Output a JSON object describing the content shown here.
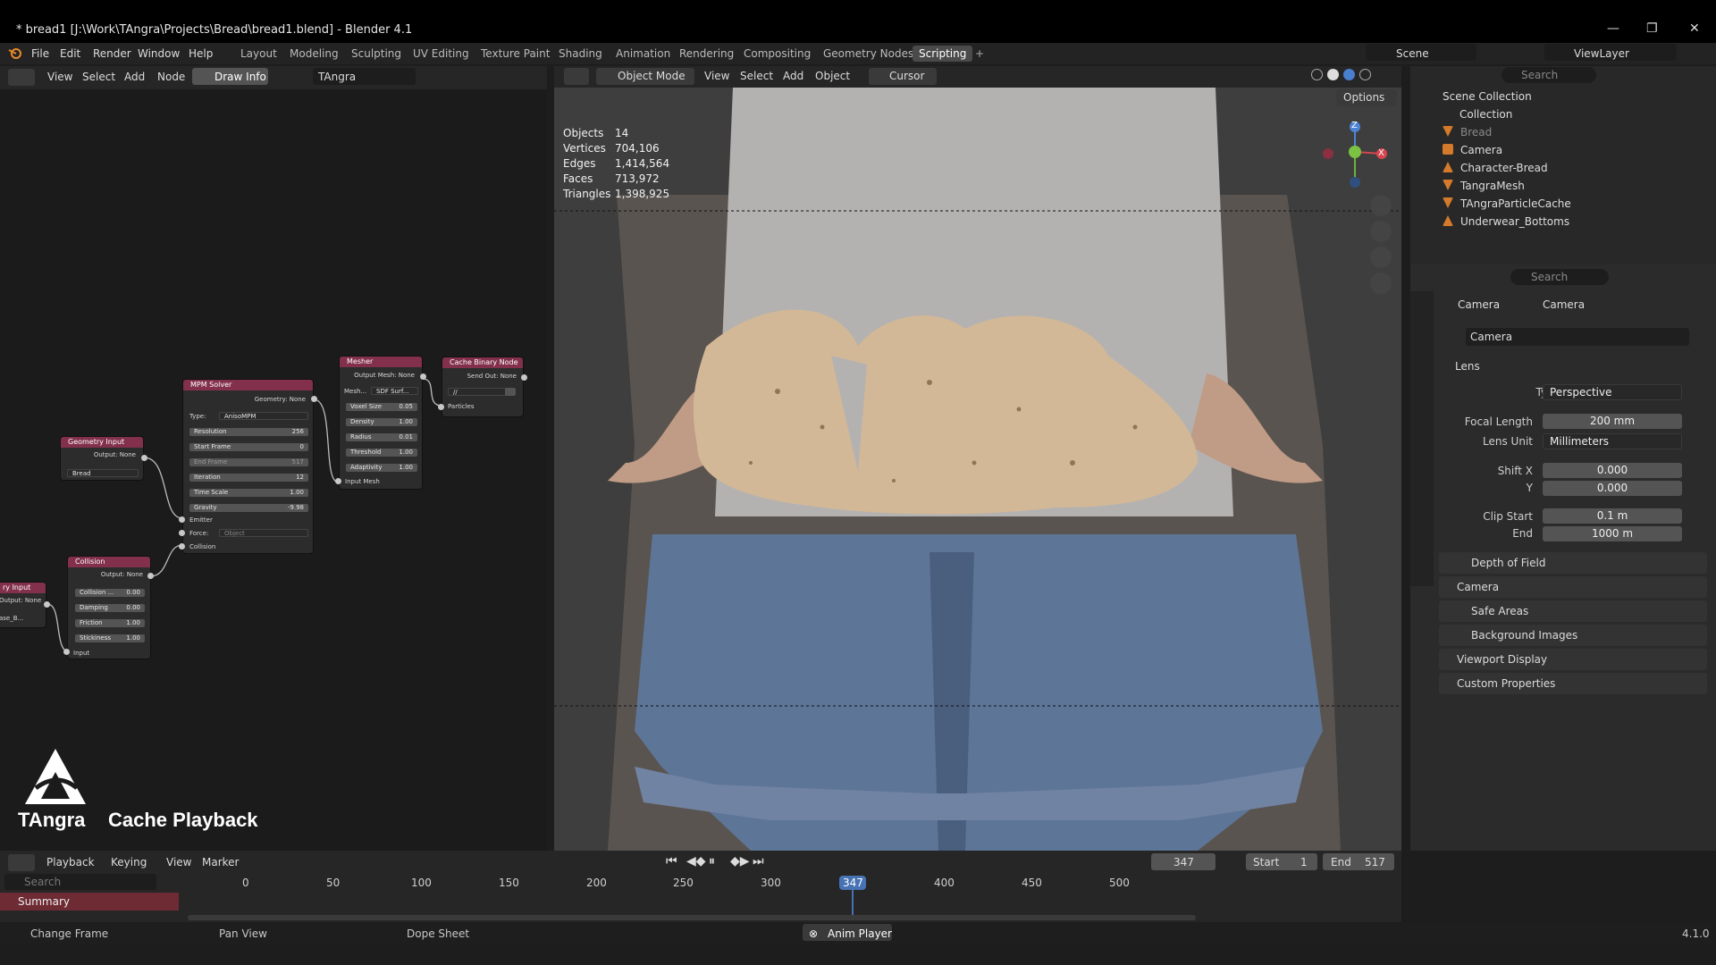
{
  "window": {
    "title": "* bread1 [J:\\Work\\TAngra\\Projects\\Bread\\bread1.blend] - Blender 4.1",
    "controls": [
      "—",
      "❐",
      "✕"
    ]
  },
  "menubar": {
    "menus": [
      "File",
      "Edit",
      "Render",
      "Window",
      "Help"
    ],
    "workspaces": [
      "Layout",
      "Modeling",
      "Sculpting",
      "UV Editing",
      "Texture Paint",
      "Shading",
      "Animation",
      "Rendering",
      "Compositing",
      "Geometry Nodes",
      "Scripting"
    ],
    "active_workspace": "Scripting",
    "scene": "Scene",
    "view_layer": "ViewLayer"
  },
  "node_editor": {
    "header": {
      "view": "View",
      "select": "Select",
      "add": "Add",
      "node": "Node",
      "draw_info": "Draw Info",
      "tree_name": "TAngra"
    },
    "nodes": {
      "geometry_input": {
        "title": "Geometry Input",
        "output": "Output: None",
        "object": "Bread"
      },
      "collision": {
        "title": "Collision",
        "output": "Output: None",
        "fields": [
          [
            "Collision ...",
            "0.00"
          ],
          [
            "Damping",
            "0.00"
          ],
          [
            "Friction",
            "1.00"
          ],
          [
            "Stickiness",
            "1.00"
          ]
        ],
        "input": "Input"
      },
      "partial_input": {
        "title": "ry Input",
        "output": "Output: None",
        "object": "ase_B..."
      },
      "mpm_solver": {
        "title": "MPM Solver",
        "output": "Geometry: None",
        "type_label": "Type:",
        "type_value": "AnisoMPM",
        "fields": [
          [
            "Resolution",
            "256"
          ],
          [
            "Start Frame",
            "0"
          ],
          [
            "End Frame",
            "517"
          ],
          [
            "Iteration",
            "12"
          ],
          [
            "Time Scale",
            "1.00"
          ],
          [
            "Gravity",
            "-9.98"
          ]
        ],
        "emitter": "Emitter",
        "force": "Force:",
        "force_value": "Object",
        "collision": "Collision"
      },
      "mesher": {
        "title": "Mesher",
        "output": "Output Mesh: None",
        "mesh_label": "Mesh...",
        "mesh_value": "SDF Surf...",
        "fields": [
          [
            "Voxel Size",
            "0.05"
          ],
          [
            "Density",
            "1.00"
          ],
          [
            "Radius",
            "0.01"
          ],
          [
            "Threshold",
            "1.00"
          ],
          [
            "Adaptivity",
            "1.00"
          ]
        ],
        "input": "Input Mesh"
      },
      "cache_binary": {
        "title": "Cache Binary Node",
        "output": "Send Out: None",
        "path": "//",
        "input": "Particles"
      }
    },
    "logo": {
      "brand": "TAngra",
      "caption": "Cache Playback"
    }
  },
  "viewport": {
    "header": {
      "mode": "Object Mode",
      "view": "View",
      "select": "Select",
      "add": "Add",
      "object": "Object",
      "pivot": "Cursor",
      "options": "Options"
    },
    "stats": [
      [
        "Objects",
        "14"
      ],
      [
        "Vertices",
        "704,106"
      ],
      [
        "Edges",
        "1,414,564"
      ],
      [
        "Faces",
        "713,972"
      ],
      [
        "Triangles",
        "1,398,925"
      ]
    ],
    "gizmo": {
      "z": "Z",
      "x": "X"
    }
  },
  "outliner": {
    "search_placeholder": "Search",
    "root": "Scene Collection",
    "collection": "Collection",
    "items": [
      "Bread",
      "Camera",
      "Character-Bread",
      "TangraMesh",
      "TAngraParticleCache",
      "Underwear_Bottoms"
    ]
  },
  "properties": {
    "search_placeholder": "Search",
    "breadcrumb": [
      "Camera",
      "Camera"
    ],
    "datablock": "Camera",
    "lens": {
      "section": "Lens",
      "type_label": "Type",
      "type_value": "Perspective",
      "focal_label": "Focal Length",
      "focal_value": "200 mm",
      "unit_label": "Lens Unit",
      "unit_value": "Millimeters",
      "shiftx_label": "Shift X",
      "shiftx_value": "0.000",
      "shifty_label": "Y",
      "shifty_value": "0.000",
      "clipstart_label": "Clip Start",
      "clipstart_value": "0.1 m",
      "clipend_label": "End",
      "clipend_value": "1000 m"
    },
    "panels": [
      "Depth of Field",
      "Camera",
      "Safe Areas",
      "Background Images",
      "Viewport Display",
      "Custom Properties"
    ]
  },
  "timeline": {
    "playback": "Playback",
    "keying": "Keying",
    "view": "View",
    "marker": "Marker",
    "current_frame": "347",
    "start_label": "Start",
    "start": "1",
    "end_label": "End",
    "end": "517",
    "search_placeholder": "Search",
    "summary": "Summary",
    "ruler": [
      "0",
      "50",
      "100",
      "150",
      "200",
      "250",
      "300",
      "347",
      "400",
      "450",
      "500"
    ]
  },
  "statusbar": {
    "change_frame": "Change Frame",
    "pan_view": "Pan View",
    "dope_sheet": "Dope Sheet",
    "anim_player": "Anim Player",
    "version": "4.1.0"
  }
}
